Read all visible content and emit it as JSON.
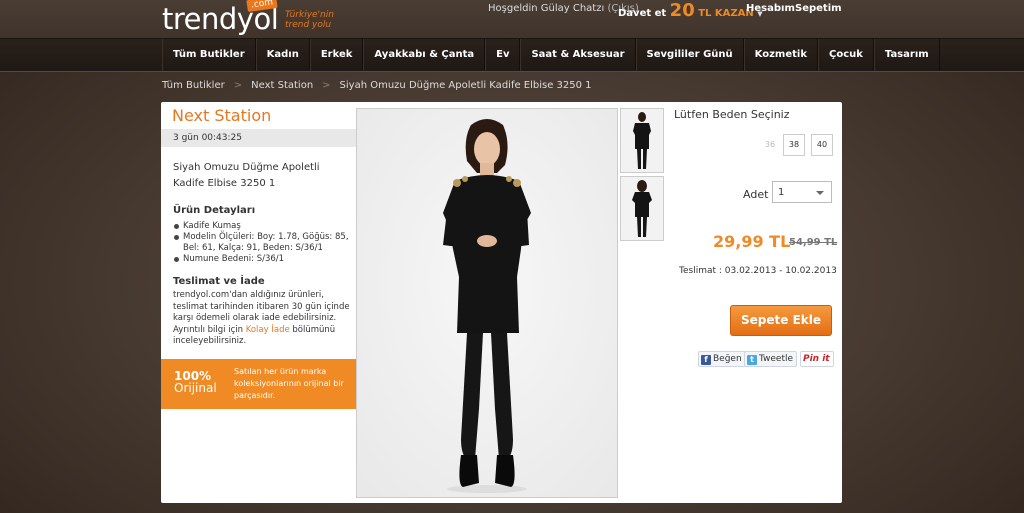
{
  "header": {
    "logo": "trendyol",
    "logo_suffix": ".com",
    "logo_tagline": "Türkiye'nin trend yolu",
    "welcome": "Hoşgeldin Gülay Chatzı",
    "exit_label": "(Çıkış)",
    "invite_prefix": "Davet et",
    "invite_amount": "20",
    "invite_suffix": "TL KAZAN",
    "account_label": "Hesabım",
    "cart_label": "Sepetim"
  },
  "nav": [
    "Tüm Butikler",
    "Kadın",
    "Erkek",
    "Ayakkabı & Çanta",
    "Ev",
    "Saat & Aksesuar",
    "Sevgililer Günü",
    "Kozmetik",
    "Çocuk",
    "Tasarım"
  ],
  "breadcrumb": [
    "Tüm Butikler",
    "Next Station",
    "Siyah Omuzu Düğme Apoletli Kadife Elbise 3250 1"
  ],
  "product": {
    "brand": "Next Station",
    "timer": "3 gün 00:43:25",
    "name": "Siyah Omuzu Düğme Apoletli Kadife Elbise 3250 1",
    "details_title": "Ürün Detayları",
    "details": [
      "Kadife Kumaş",
      "Modelin Ölçüleri: Boy: 1.78, Göğüs: 85, Bel: 61, Kalça: 91, Beden: S/36/1",
      "Numune Bedeni: S/36/1"
    ],
    "shipping_title": "Teslimat ve İade",
    "shipping_text_1": "trendyol.com'dan aldığınız ürünleri, teslimat tarihinden itibaren 30 gün içinde karşı ödemeli olarak iade edebilirsiniz. Ayrıntılı bilgi için ",
    "shipping_link": "Kolay İade",
    "shipping_text_2": " bölümünü inceleyebilirsiniz.",
    "original_big": "100%",
    "original_sub": "Orijinal",
    "original_text": "Satılan her ürün marka koleksiyonlarının orijinal bir parçasıdır.",
    "size_title": "Lütfen Beden Seçiniz",
    "sizes": [
      "36",
      "38",
      "40"
    ],
    "qty_label": "Adet",
    "qty_value": "1",
    "price": "29,99 TL",
    "old_price": "54,99 TL",
    "delivery": "Teslimat : 03.02.2013 - 10.02.2013",
    "cart_button": "Sepete Ekle",
    "social": {
      "like": "Beğen",
      "tweet": "Tweetle",
      "pin": "Pin it"
    }
  },
  "colors": {
    "accent": "#f08a24",
    "bg": "#46392f",
    "nav": "#231b16"
  }
}
